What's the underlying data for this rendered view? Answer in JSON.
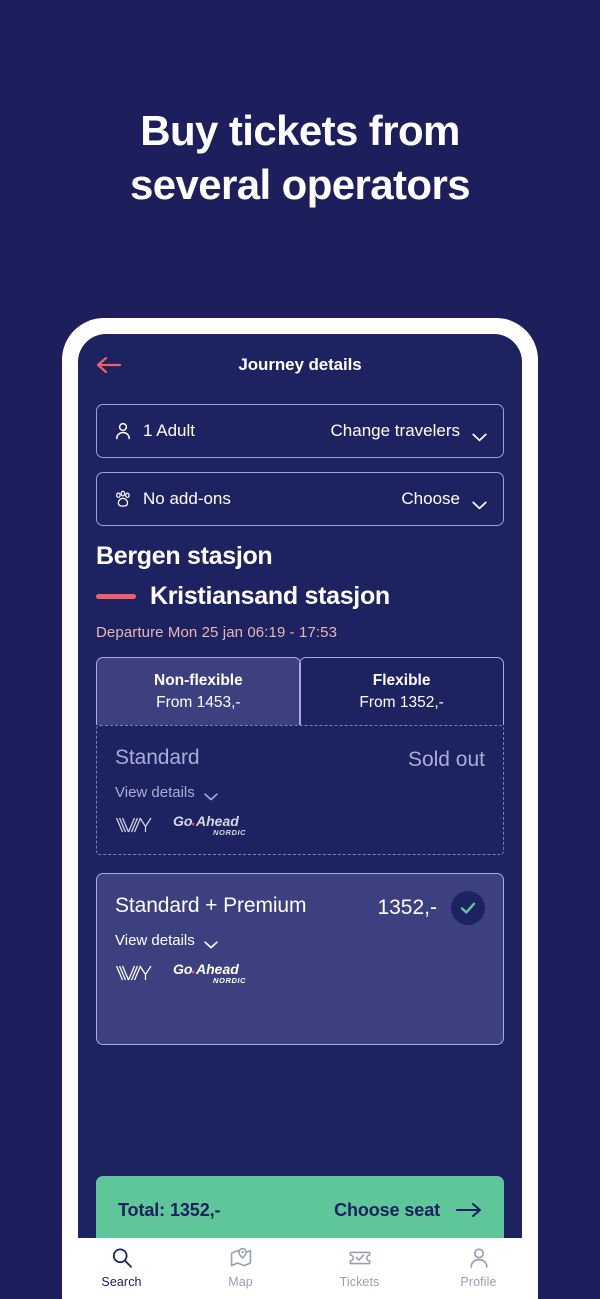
{
  "hero": {
    "line1": "Buy tickets from",
    "line2": "several operators"
  },
  "colors": {
    "page_background": "#1d1f5c",
    "screen_background": "#1d2260",
    "accent_coral": "#ee5f69",
    "accent_green": "#5ec698",
    "border_lavender": "#a6abe6",
    "card_selected_fill": "#3d407f",
    "departure_text": "#e8b7b4",
    "dim_text": "#a9aed6"
  },
  "app": {
    "title": "Journey details",
    "back_icon": "arrow-left-icon"
  },
  "travelers": {
    "icon": "person-icon",
    "value": "1 Adult",
    "action": "Change travelers",
    "chevron": "chevron-down-icon"
  },
  "addons": {
    "icon": "paw-print-icon",
    "value": "No add-ons",
    "action": "Choose",
    "chevron": "chevron-down-icon"
  },
  "journey": {
    "from_station": "Bergen stasjon",
    "to_station": "Kristiansand stasjon",
    "departure": "Departure Mon 25 jan 06:19 - 17:53"
  },
  "fare_tabs": [
    {
      "title": "Non-flexible",
      "price": "From 1453,-",
      "selected": true
    },
    {
      "title": "Flexible",
      "price": "From 1352,-",
      "selected": false
    }
  ],
  "fare_options": [
    {
      "name": "Standard",
      "status": "Sold out",
      "price": "",
      "details_label": "View details",
      "chevron": "chevron-down-icon",
      "sold_out": true,
      "selected": false,
      "operators": [
        "vy-logo",
        "go-ahead-nordic-logo"
      ]
    },
    {
      "name": "Standard + Premium",
      "status": "",
      "price": "1352,-",
      "details_label": "View details",
      "chevron": "chevron-down-icon",
      "sold_out": false,
      "selected": true,
      "check_icon": "check-circle-icon",
      "operators": [
        "vy-logo",
        "go-ahead-nordic-logo"
      ]
    }
  ],
  "cta": {
    "total": "Total: 1352,-",
    "action": "Choose seat",
    "arrow": "arrow-right-icon"
  },
  "bottom_nav": [
    {
      "label": "Search",
      "icon": "search-icon",
      "active": true
    },
    {
      "label": "Map",
      "icon": "map-pin-icon",
      "active": false
    },
    {
      "label": "Tickets",
      "icon": "ticket-icon",
      "active": false
    },
    {
      "label": "Profile",
      "icon": "person-icon",
      "active": false
    }
  ]
}
